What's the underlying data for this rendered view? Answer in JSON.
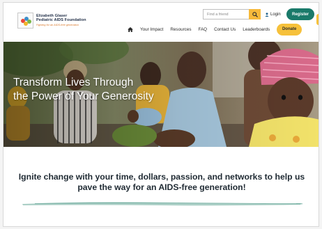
{
  "brand": {
    "line1": "Elizabeth Glaser",
    "line2": "Pediatric AIDS Foundation",
    "tagline": "Fighting for an AIDS-free generation"
  },
  "header": {
    "search_placeholder": "Find a friend",
    "search_icon": "search-icon",
    "login_label": "Login",
    "register_label": "Register",
    "donate_label": "Donate"
  },
  "nav": {
    "home_icon": "home-icon",
    "items": [
      "Your Impact",
      "Resources",
      "FAQ",
      "Contact Us",
      "Leaderboards"
    ]
  },
  "hero": {
    "title_line1": "Transform Lives Through",
    "title_line2": "the Power of Your Generosity"
  },
  "main": {
    "tagline": "Ignite change with your time, dollars, passion, and networks to help us pave the way for an AIDS-free generation!"
  },
  "colors": {
    "primary_teal": "#1a7a6a",
    "accent_yellow": "#f6c13b",
    "search_button": "#f6b93b",
    "text_dark": "#1f2a33"
  }
}
